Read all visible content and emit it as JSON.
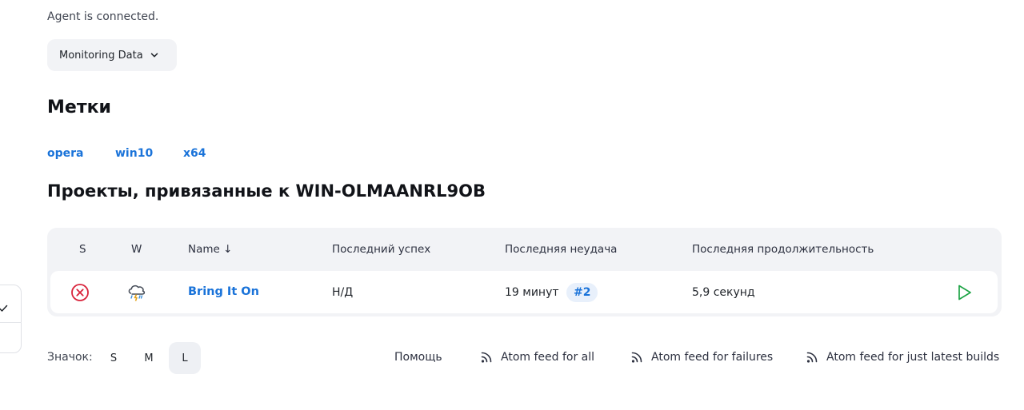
{
  "status": "Agent is connected.",
  "monitoring_button": "Monitoring Data",
  "labels_heading": "Метки",
  "labels": [
    "opera",
    "win10",
    "x64"
  ],
  "projects_heading": "Проекты, привязанные к WIN-OLMAANRL9OB",
  "table": {
    "columns": {
      "s": "S",
      "w": "W",
      "name": "Name ↓",
      "last_success": "Последний успех",
      "last_failure": "Последняя неудача",
      "last_duration": "Последняя продолжительность"
    },
    "rows": [
      {
        "status_icon": "failed-x-icon",
        "weather_icon": "storm-cloud-icon",
        "name": "Bring It On",
        "last_success": "Н/Д",
        "last_failure": "19 минут",
        "failure_build": "#2",
        "last_duration": "5,9 секунд",
        "action_icon": "play-icon"
      }
    ]
  },
  "footer": {
    "icon_label": "Значок:",
    "sizes": [
      "S",
      "M",
      "L"
    ],
    "active_size": "L",
    "help": "Помощь",
    "feeds": [
      "Atom feed for all",
      "Atom feed for failures",
      "Atom feed for just latest builds"
    ]
  },
  "colors": {
    "link": "#1a73d9",
    "failure": "#d9243c",
    "success": "#1ea446",
    "table_bg": "#f2f3f6"
  }
}
